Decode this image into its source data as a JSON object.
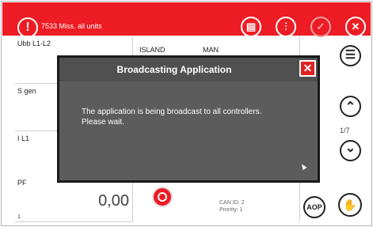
{
  "topbar": {
    "alarm_icon": "!",
    "alarm_text": "7533 Miss. all units",
    "buttons": [
      {
        "name": "document-icon",
        "glyph": "▤"
      },
      {
        "name": "sliders-icon",
        "glyph": "⫶"
      },
      {
        "name": "checkmark-icon",
        "glyph": "✓"
      },
      {
        "name": "close-icon",
        "glyph": "✕"
      }
    ]
  },
  "tiles": [
    {
      "label": "Ubb L1-L2",
      "value": ""
    },
    {
      "label": "S gen",
      "value": ""
    },
    {
      "label": "I L1",
      "value": ""
    },
    {
      "label": "PF",
      "value": "0,00",
      "small": "1"
    }
  ],
  "col2": {
    "label_a": "ISLAND",
    "label_b": "MAN"
  },
  "can_info": {
    "line1": "CAN ID: 2",
    "line2": "Priority: 1"
  },
  "side": {
    "menu_glyph": "☰",
    "up_glyph": "⌃",
    "down_glyph": "⌄",
    "page": "1/7",
    "aop_label": "AOP",
    "hand_glyph": "✋"
  },
  "modal": {
    "title": "Broadcasting Application",
    "close_glyph": "✕",
    "message": "The application is being broadcast to all controllers. Please wait."
  },
  "colors": {
    "accent": "#ee1c24",
    "modal_bg": "#5c5c5c"
  }
}
